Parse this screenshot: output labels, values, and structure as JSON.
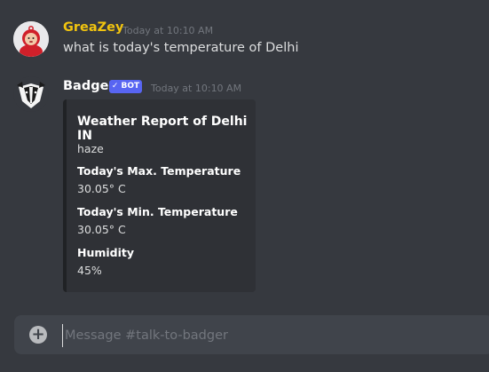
{
  "user_message": {
    "username": "GreaZey",
    "username_color": "#f1c40f",
    "timestamp": "Today at 10:10 AM",
    "text": "what is today's temperature of Delhi"
  },
  "bot_message": {
    "username": "Badger",
    "username_color": "#ffffff",
    "bot_tag": "BOT",
    "timestamp": "Today at 10:10 AM",
    "embed": {
      "title": "Weather Report of Delhi IN",
      "description": "haze",
      "fields": [
        {
          "name": "Today's Max. Temperature",
          "value": "30.05° C"
        },
        {
          "name": "Today's Min. Temperature",
          "value": "30.05° C"
        },
        {
          "name": "Humidity",
          "value": "45%"
        }
      ]
    }
  },
  "composer": {
    "placeholder": "Message #talk-to-badger",
    "icon": "plus-circle-icon"
  }
}
